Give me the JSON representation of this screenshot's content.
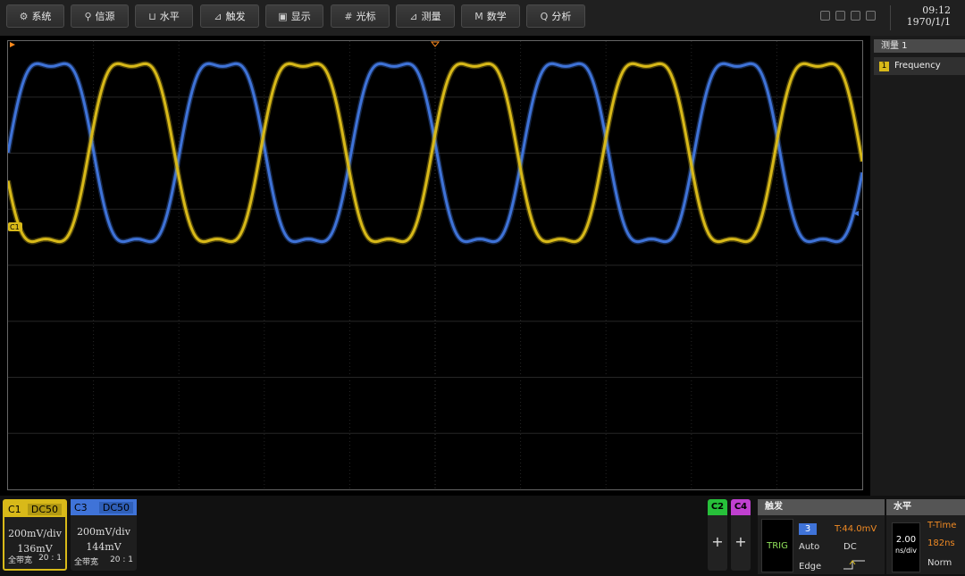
{
  "toolbar": {
    "buttons": [
      {
        "icon": "⚙",
        "label": "系统"
      },
      {
        "icon": "⚲",
        "label": "信源"
      },
      {
        "icon": "⊔",
        "label": "水平"
      },
      {
        "icon": "⊿",
        "label": "触发"
      },
      {
        "icon": "▣",
        "label": "显示"
      },
      {
        "icon": "#",
        "label": "光标"
      },
      {
        "icon": "⊿",
        "label": "测量"
      },
      {
        "icon": "M",
        "label": "数学"
      },
      {
        "icon": "Q",
        "label": "分析"
      }
    ],
    "time": "09:12",
    "date": "1970/1/1"
  },
  "measurement": {
    "header": "测量 1",
    "items": [
      {
        "badge": "1",
        "name": "Frequency"
      }
    ]
  },
  "channels": {
    "c1": {
      "name": "C1",
      "coupling": "DC50",
      "scale": "200mV/div",
      "offset": "136mV",
      "bandwidth": "全带宽",
      "probe": "20 : 1",
      "color": "#d8b919"
    },
    "c3": {
      "name": "C3",
      "coupling": "DC50",
      "scale": "200mV/div",
      "offset": "144mV",
      "bandwidth": "全带宽",
      "probe": "20 : 1",
      "color": "#3f73d8"
    },
    "c2": {
      "name": "C2",
      "color": "#27c03a"
    },
    "c4": {
      "name": "C4",
      "color": "#c040d0"
    }
  },
  "trigger": {
    "header": "触发",
    "badge": "TRIG",
    "source": "3",
    "level": "T:44.0mV",
    "mode": "Auto",
    "coupling": "DC",
    "type": "Edge"
  },
  "horizontal": {
    "header": "水平",
    "scale_value": "2.00",
    "scale_unit": "ns/div",
    "time_label": "T-Time",
    "time_value": "182ns",
    "mode": "Norm"
  },
  "markers": {
    "c1_marker": "C1"
  },
  "colors": {
    "yellow": "#d8b919",
    "blue": "#3f73d8",
    "orange": "#ff8a1c"
  }
}
